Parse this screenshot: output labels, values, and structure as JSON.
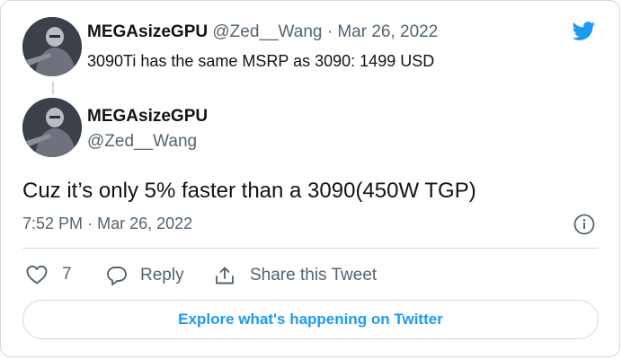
{
  "quoted_tweet": {
    "display_name": "MEGAsizeGPU",
    "handle": "@Zed__Wang",
    "separator": "·",
    "date": "Mar 26, 2022",
    "text": "3090Ti has the same MSRP as 3090: 1499 USD"
  },
  "main_tweet": {
    "display_name": "MEGAsizeGPU",
    "handle": "@Zed__Wang",
    "text": "Cuz it’s only 5% faster than a 3090(450W TGP)",
    "time": "7:52 PM",
    "separator": "·",
    "date": "Mar 26, 2022"
  },
  "actions": {
    "like_count": "7",
    "reply_label": "Reply",
    "share_label": "Share this Tweet"
  },
  "explore_label": "Explore what's happening on Twitter",
  "colors": {
    "accent": "#1d9bf0",
    "text": "#0f1419",
    "muted": "#536471",
    "border": "#cfd9de"
  },
  "icons": [
    "twitter-bird-icon",
    "info-icon",
    "heart-icon",
    "reply-bubble-icon",
    "share-icon"
  ]
}
